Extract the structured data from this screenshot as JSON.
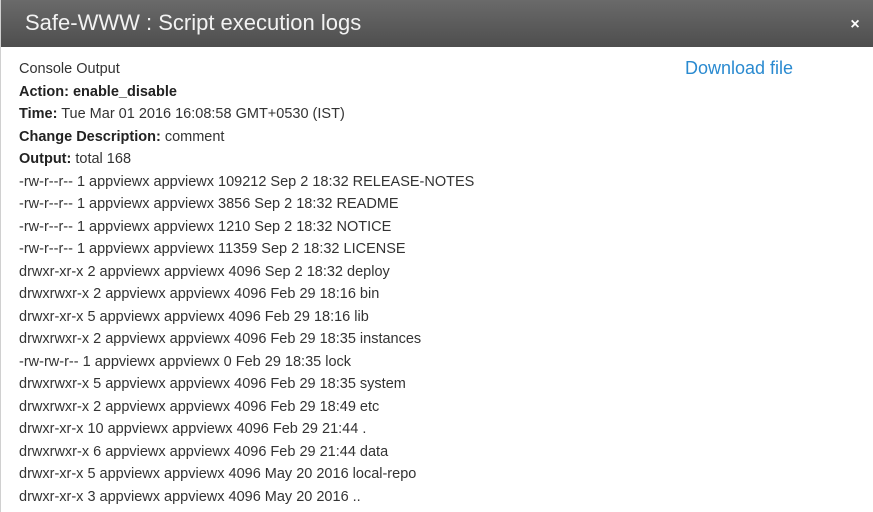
{
  "dialog": {
    "title": "Safe-WWW : Script execution logs",
    "close_glyph": "×"
  },
  "log": {
    "heading": "Console Output",
    "download_label": "Download file",
    "action_label": "Action: enable_disable",
    "time_label": "Time:",
    "time_value": "Tue Mar 01 2016 16:08:58 GMT+0530 (IST)",
    "change_label": "Change Description:",
    "change_value": "comment",
    "output_label": "Output:",
    "output_value": "total 168",
    "lines": [
      "-rw-r--r-- 1 appviewx appviewx 109212 Sep 2 18:32 RELEASE-NOTES",
      "-rw-r--r-- 1 appviewx appviewx 3856 Sep 2 18:32 README",
      "-rw-r--r-- 1 appviewx appviewx 1210 Sep 2 18:32 NOTICE",
      "-rw-r--r-- 1 appviewx appviewx 11359 Sep 2 18:32 LICENSE",
      "drwxr-xr-x 2 appviewx appviewx 4096 Sep 2 18:32 deploy",
      "drwxrwxr-x 2 appviewx appviewx 4096 Feb 29 18:16 bin",
      "drwxr-xr-x 5 appviewx appviewx 4096 Feb 29 18:16 lib",
      "drwxrwxr-x 2 appviewx appviewx 4096 Feb 29 18:35 instances",
      "-rw-rw-r-- 1 appviewx appviewx 0 Feb 29 18:35 lock",
      "drwxrwxr-x 5 appviewx appviewx 4096 Feb 29 18:35 system",
      "drwxrwxr-x 2 appviewx appviewx 4096 Feb 29 18:49 etc",
      "drwxr-xr-x 10 appviewx appviewx 4096 Feb 29 21:44 .",
      "drwxrwxr-x 6 appviewx appviewx 4096 Feb 29 21:44 data",
      "drwxr-xr-x 5 appviewx appviewx 4096 May 20 2016 local-repo",
      "drwxr-xr-x 3 appviewx appviewx 4096 May 20 2016 .."
    ]
  }
}
